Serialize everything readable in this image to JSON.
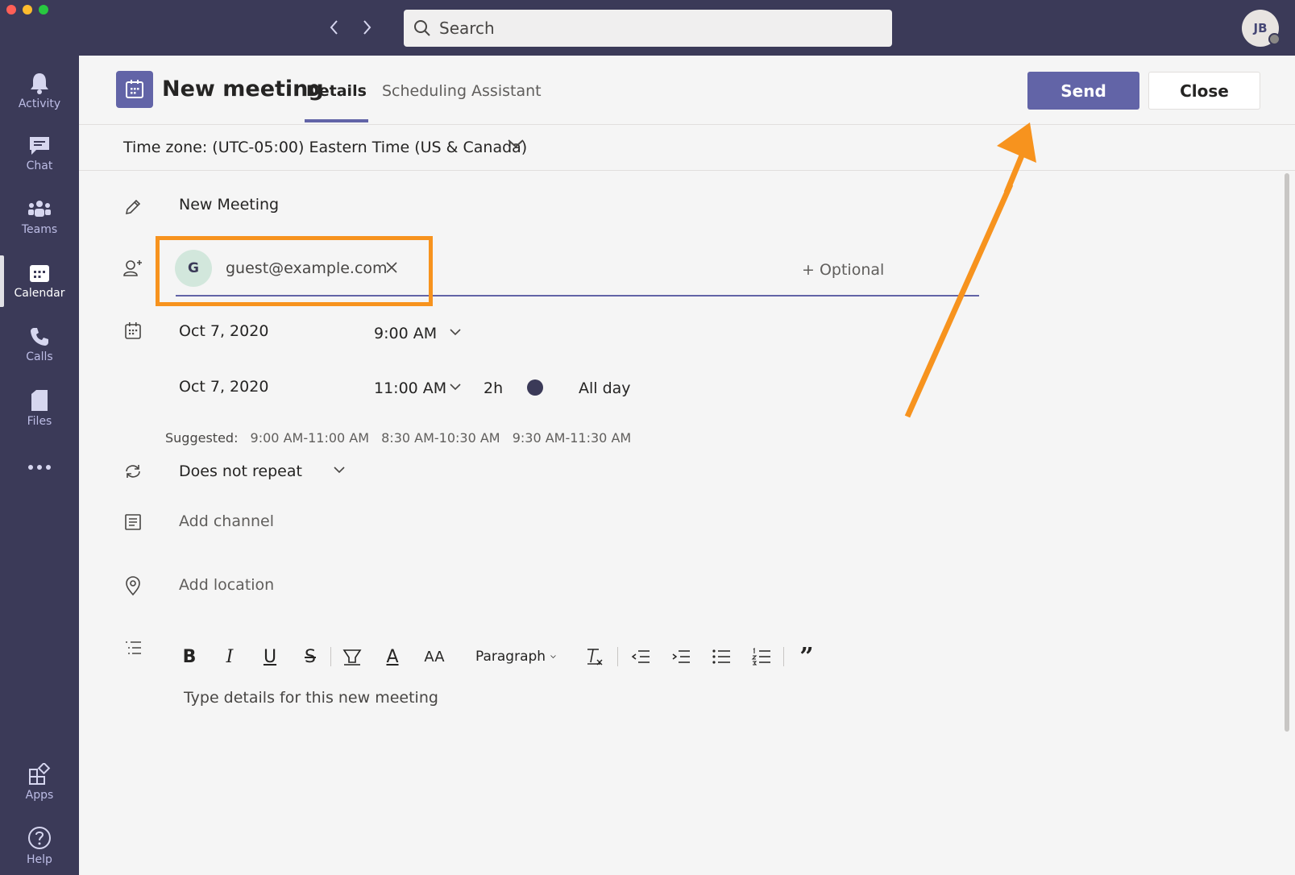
{
  "window": {
    "search_placeholder": "Search",
    "user_initials": "JB"
  },
  "rail": {
    "items": [
      {
        "label": "Activity",
        "icon": "bell-icon"
      },
      {
        "label": "Chat",
        "icon": "chat-icon"
      },
      {
        "label": "Teams",
        "icon": "teams-icon"
      },
      {
        "label": "Calendar",
        "icon": "calendar-icon",
        "active": true
      },
      {
        "label": "Calls",
        "icon": "phone-icon"
      },
      {
        "label": "Files",
        "icon": "file-icon"
      },
      {
        "label": "...",
        "icon": "more-icon"
      }
    ],
    "bottom": [
      {
        "label": "Apps",
        "icon": "apps-icon"
      },
      {
        "label": "Help",
        "icon": "help-icon"
      }
    ]
  },
  "header": {
    "title": "New meeting",
    "tabs": [
      {
        "label": "Details",
        "active": true
      },
      {
        "label": "Scheduling Assistant"
      }
    ],
    "send_label": "Send",
    "close_label": "Close"
  },
  "timezone": {
    "label": "Time zone: (UTC-05:00) Eastern Time (US & Canada)"
  },
  "form": {
    "title_value": "New Meeting",
    "attendee": {
      "initial": "G",
      "email": "guest@example.com"
    },
    "optional_label": "+ Optional",
    "start_date": "Oct 7, 2020",
    "start_time": "9:00 AM",
    "end_date": "Oct 7, 2020",
    "end_time": "11:00 AM",
    "duration": "2h",
    "all_day_label": "All day",
    "suggested_label": "Suggested:",
    "suggested_slots": [
      "9:00 AM-11:00 AM",
      "8:30 AM-10:30 AM",
      "9:30 AM-11:30 AM"
    ],
    "repeat_value": "Does not repeat",
    "channel_placeholder": "Add channel",
    "location_placeholder": "Add location",
    "toolbar": {
      "bold": "B",
      "italic": "I",
      "underline": "U",
      "strike": "S",
      "font_size": "AA",
      "font_color": "A",
      "paragraph": "Paragraph",
      "quote": "”"
    },
    "editor_placeholder": "Type details for this new meeting"
  },
  "colors": {
    "accent": "#6264a7",
    "highlight": "#f7931e",
    "rail": "#3b3a58"
  }
}
